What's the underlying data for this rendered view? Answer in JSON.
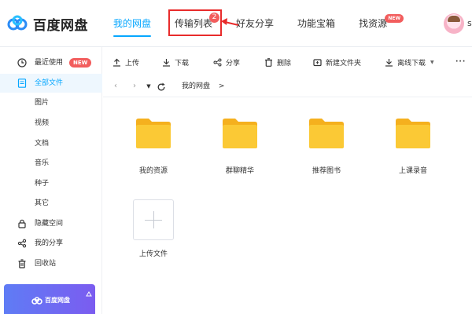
{
  "app": {
    "logo_text": "百度网盘",
    "accent_color": "#06a7ff",
    "badge_color": "#f25d5d",
    "folder_color": "#f9c732",
    "annotation_color": "#e82b2b"
  },
  "topnav": {
    "items": [
      {
        "label": "我的网盘",
        "active": true
      },
      {
        "label": "传输列表",
        "badge": "2"
      },
      {
        "label": "好友分享"
      },
      {
        "label": "功能宝箱"
      },
      {
        "label": "找资源",
        "badge": "NEW"
      }
    ]
  },
  "user": {
    "name": "s",
    "avatar_icon": "anime-avatar"
  },
  "sidebar": {
    "items": [
      {
        "label": "最近使用",
        "icon": "clock-icon",
        "badge": "NEW"
      },
      {
        "label": "全部文件",
        "icon": "file-list-icon",
        "active": true
      },
      {
        "label": "图片"
      },
      {
        "label": "视频"
      },
      {
        "label": "文档"
      },
      {
        "label": "音乐"
      },
      {
        "label": "种子"
      },
      {
        "label": "其它"
      },
      {
        "label": "隐藏空间",
        "icon": "lock-icon"
      },
      {
        "label": "我的分享",
        "icon": "share-icon"
      },
      {
        "label": "回收站",
        "icon": "trash-icon"
      }
    ],
    "promo": {
      "label": "百度网盘"
    }
  },
  "toolbar": {
    "items": [
      {
        "label": "上传",
        "icon": "upload-icon"
      },
      {
        "label": "下载",
        "icon": "download-icon"
      },
      {
        "label": "分享",
        "icon": "share-icon"
      },
      {
        "label": "删除",
        "icon": "trash-icon"
      },
      {
        "label": "新建文件夹",
        "icon": "new-folder-icon"
      },
      {
        "label": "离线下载",
        "icon": "offline-download-icon",
        "dropdown": true
      },
      {
        "label": "···",
        "icon": "more-icon"
      }
    ]
  },
  "breadcrumb": {
    "path": "我的网盘",
    "separator": ">"
  },
  "files": [
    {
      "name": "我的资源",
      "icon": "folder-icon"
    },
    {
      "name": "群聊精华",
      "icon": "folder-icon"
    },
    {
      "name": "推荐图书",
      "icon": "folder-icon"
    },
    {
      "name": "上课录音",
      "icon": "folder-icon"
    }
  ],
  "upload_tile": {
    "label": "上传文件"
  }
}
